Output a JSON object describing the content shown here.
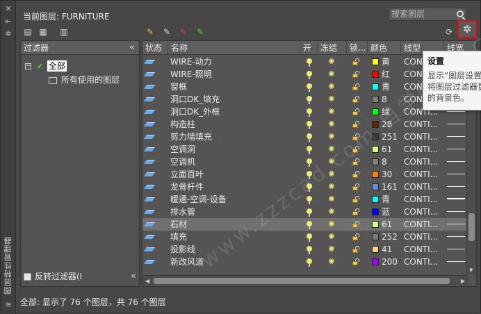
{
  "sidebar": {
    "vertical_title": "图层特性管理器"
  },
  "header": {
    "current_layer_label": "当前图层: FURNITURE",
    "search_placeholder": "搜索图层"
  },
  "filters": {
    "title": "过滤器",
    "tree_root": "全部",
    "tree_child": "所有使用的图层",
    "invert_label": "反转过滤器(I"
  },
  "columns": {
    "status": "状态",
    "name": "名称",
    "on": "开",
    "freeze": "冻结",
    "lock": "锁...",
    "color": "颜色",
    "linetype": "线型",
    "lineweight": "线宽"
  },
  "layers": [
    {
      "name": "WIRE-动力",
      "color_name": "黄",
      "color_hex": "#ffff00",
      "linetype": "CONTI...",
      "lw": "thin"
    },
    {
      "name": "WIRE-照明",
      "color_name": "红",
      "color_hex": "#ff0000",
      "linetype": "CONTI...",
      "lw": "thin"
    },
    {
      "name": "窗框",
      "color_name": "青",
      "color_hex": "#00ffff",
      "linetype": "CONTI...",
      "lw": "thin"
    },
    {
      "name": "洞口DK_填充",
      "color_name": "8",
      "color_hex": "#808080",
      "linetype": "CONTI...",
      "lw": "thin"
    },
    {
      "name": "洞口DK_外框",
      "color_name": "绿",
      "color_hex": "#00ff00",
      "linetype": "CONTI...",
      "lw": "thin"
    },
    {
      "name": "构造柱",
      "color_name": "28",
      "color_hex": "#5a2a00",
      "linetype": "CONTI...",
      "lw": "thin"
    },
    {
      "name": "剪力墙填充",
      "color_name": "251",
      "color_hex": "#3a3a3a",
      "linetype": "CONTI...",
      "lw": "thin"
    },
    {
      "name": "空调洞",
      "color_name": "61",
      "color_hex": "#d4ff7f",
      "linetype": "CONTI...",
      "lw": "thin"
    },
    {
      "name": "空调机",
      "color_name": "8",
      "color_hex": "#808080",
      "linetype": "CONTI...",
      "lw": "thin"
    },
    {
      "name": "立面百叶",
      "color_name": "30",
      "color_hex": "#ff7f00",
      "linetype": "CONTI...",
      "lw": "thin"
    },
    {
      "name": "龙骨杆件",
      "color_name": "161",
      "color_hex": "#6a8ad4",
      "linetype": "CONTI...",
      "lw": "thin"
    },
    {
      "name": "暖通-空调-设备",
      "color_name": "青",
      "color_hex": "#00ffff",
      "linetype": "CONTI...",
      "lw": "thick"
    },
    {
      "name": "排水管",
      "color_name": "蓝",
      "color_hex": "#0000ff",
      "linetype": "CONTI...",
      "lw": "thin"
    },
    {
      "name": "石材",
      "color_name": "61",
      "color_hex": "#d4ff7f",
      "linetype": "CONTI...",
      "lw": "thin"
    },
    {
      "name": "填充",
      "color_name": "252",
      "color_hex": "#7a7a7a",
      "linetype": "CONTI...",
      "lw": "thin"
    },
    {
      "name": "投影线",
      "color_name": "41",
      "color_hex": "#ffd27f",
      "linetype": "CONTI...",
      "lw": "thin"
    },
    {
      "name": "新改风道",
      "color_name": "200",
      "color_hex": "#a000ff",
      "linetype": "CONTI...",
      "lw": "thin"
    }
  ],
  "selected_layer": "石材",
  "status_bar": "全部: 显示了 76 个图层，共 76 个图层",
  "tooltip": {
    "title": "设置",
    "line1": "显示“图层设置",
    "line2": "将图层过滤器更",
    "line3": "的背景色。"
  },
  "watermark": "www.zzzcad.com 自学网站长CAD",
  "accent": {
    "highlight_border": "#e01010",
    "status_icon": "#6aa8e8"
  }
}
